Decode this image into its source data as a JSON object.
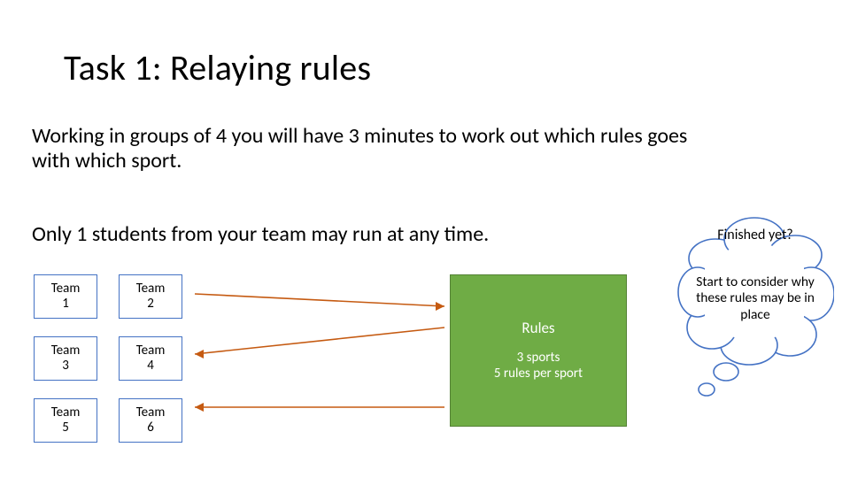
{
  "title": "Task 1: Relaying rules",
  "body": {
    "p1": "Working in groups of 4 you will have 3 minutes to work out which rules goes with which sport.",
    "p2": "Only 1 students from your team may run at any time."
  },
  "teams": {
    "items": [
      {
        "label": "Team\n1"
      },
      {
        "label": "Team\n2"
      },
      {
        "label": "Team\n3"
      },
      {
        "label": "Team\n4"
      },
      {
        "label": "Team\n5"
      },
      {
        "label": "Team\n6"
      }
    ]
  },
  "rules": {
    "title": "Rules",
    "line1": "3 sports",
    "line2": "5 rules per sport"
  },
  "cloud": {
    "q": "Finished yet?",
    "tip": "Start to consider why these rules may be in place"
  },
  "colors": {
    "team_border": "#4472c4",
    "rules_bg": "#6fac45",
    "rules_border": "#548235",
    "arrow": "#c55a11",
    "cloud_stroke": "#4472c4"
  }
}
